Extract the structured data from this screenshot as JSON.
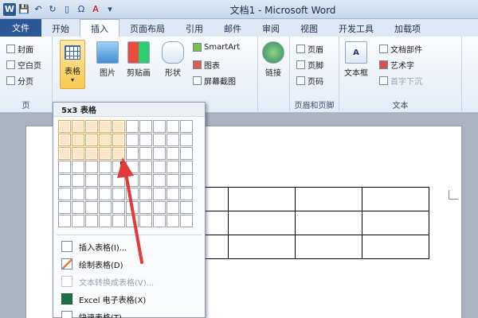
{
  "title": "文档1 - Microsoft Word",
  "qat": {
    "app_icon": "W",
    "icons": [
      "save-icon",
      "undo-icon",
      "redo-icon",
      "new-doc-icon",
      "symbol-icon",
      "font-color-icon",
      "customize-icon"
    ]
  },
  "tabs": [
    "文件",
    "开始",
    "插入",
    "页面布局",
    "引用",
    "邮件",
    "审阅",
    "视图",
    "开发工具",
    "加载项"
  ],
  "ribbon": {
    "pages_group": {
      "label": "页",
      "items": [
        "封面",
        "空白页",
        "分页"
      ]
    },
    "table_btn": "表格",
    "picture": "图片",
    "clipart": "剪贴画",
    "shapes": "形状",
    "smartart": "SmartArt",
    "chart": "图表",
    "screenshot": "屏幕截图",
    "link": "链接",
    "header_footer_group": {
      "label": "页眉和页脚",
      "items": [
        "页眉",
        "页脚",
        "页码"
      ]
    },
    "text_group": {
      "label": "文本",
      "textbox": "文本框",
      "items": [
        "文档部件",
        "艺术字",
        "首字下沉"
      ]
    }
  },
  "dropdown": {
    "title": "5x3 表格",
    "grid": {
      "cols": 10,
      "rows": 8,
      "sel_cols": 5,
      "sel_rows": 3
    },
    "items": [
      {
        "label": "插入表格(I)...",
        "disabled": false
      },
      {
        "label": "绘制表格(D)",
        "disabled": false
      },
      {
        "label": "文本转换成表格(V)...",
        "disabled": true
      },
      {
        "label": "Excel 电子表格(X)",
        "disabled": false
      },
      {
        "label": "快速表格(T)",
        "disabled": false
      }
    ]
  },
  "colors": {
    "accent": "#2b5797",
    "selection": "#f0a24a",
    "arrow": "#e33a3a"
  }
}
